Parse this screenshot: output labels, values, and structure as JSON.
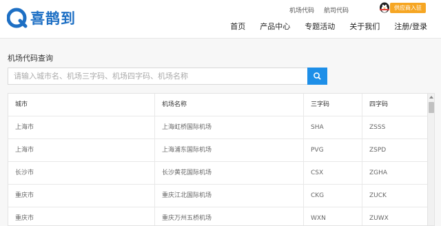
{
  "brand": {
    "name": "喜鹊到",
    "logo_icon": "logo-icon",
    "color": "#1d6fc4"
  },
  "toplinks": [
    {
      "label": "机场代码"
    },
    {
      "label": "航司代码"
    }
  ],
  "join_button": {
    "label": "供应商入驻",
    "color": "#f6a623"
  },
  "mascot_icon": "penguin-mascot-icon",
  "nav": [
    {
      "label": "首页"
    },
    {
      "label": "产品中心"
    },
    {
      "label": "专题活动"
    },
    {
      "label": "关于我们"
    },
    {
      "label": "注册/登录"
    }
  ],
  "page": {
    "title": "机场代码查询"
  },
  "search": {
    "placeholder": "请输入城市名、机场三字码、机场四字码、机场名称",
    "value": "",
    "button_icon": "search-icon",
    "button_color": "#1e8fe8"
  },
  "table": {
    "headers": [
      "城市",
      "机场名称",
      "三字码",
      "四字码"
    ],
    "rows": [
      [
        "上海市",
        "上海虹桥国际机场",
        "SHA",
        "ZSSS"
      ],
      [
        "上海市",
        "上海浦东国际机场",
        "PVG",
        "ZSPD"
      ],
      [
        "长沙市",
        "长沙黄花国际机场",
        "CSX",
        "ZGHA"
      ],
      [
        "重庆市",
        "重庆江北国际机场",
        "CKG",
        "ZUCK"
      ],
      [
        "重庆市",
        "重庆万州五桥机场",
        "WXN",
        "ZUWX"
      ]
    ]
  }
}
